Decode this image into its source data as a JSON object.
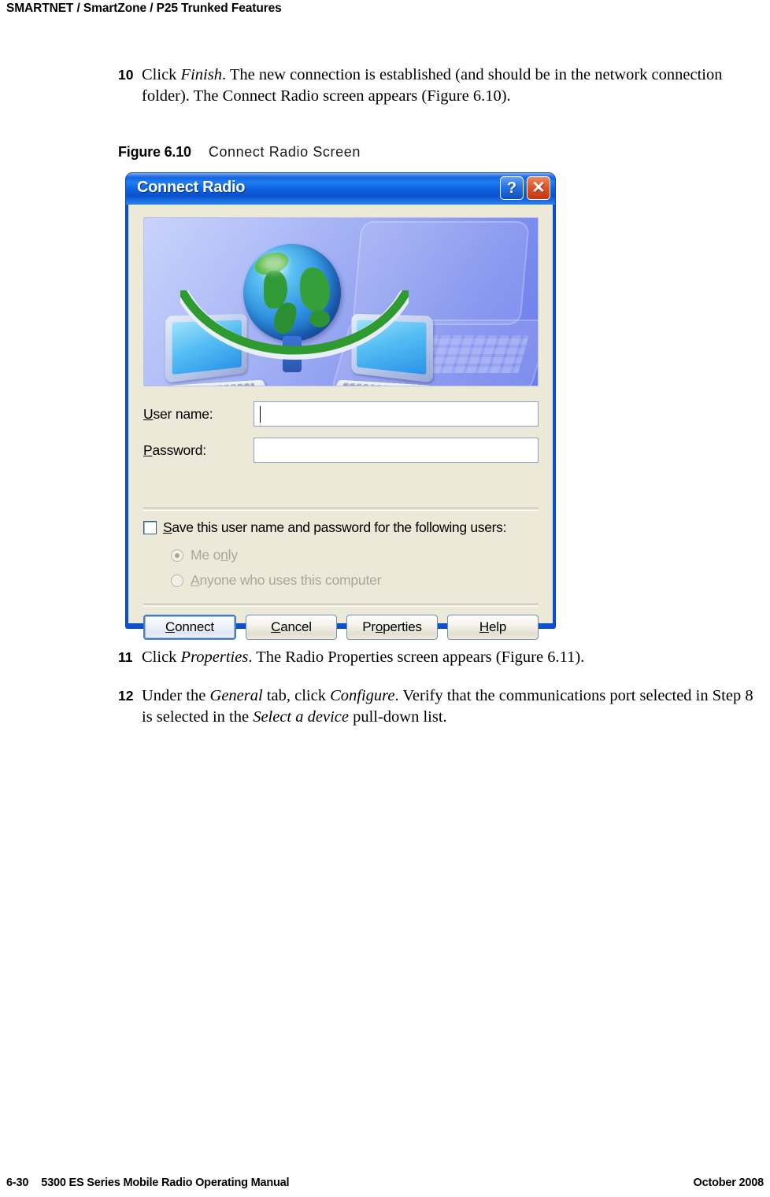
{
  "header": {
    "running_head": "SMARTNET / SmartZone / P25 Trunked Features"
  },
  "steps": [
    {
      "number": "10",
      "text_parts": [
        {
          "text": "Click ",
          "style": "normal"
        },
        {
          "text": "Finish",
          "style": "italic"
        },
        {
          "text": ". The new connection is established (and should be in the network connection folder). The Connect Radio screen appears (Figure 6.10).",
          "style": "normal"
        }
      ],
      "plain": "Click Finish. The new connection is established (and should be in the network connection folder). The Connect Radio screen appears (Figure 6.10)."
    },
    {
      "number": "11",
      "text_parts": [
        {
          "text": "Click ",
          "style": "normal"
        },
        {
          "text": "Properties",
          "style": "italic"
        },
        {
          "text": ". The Radio Properties screen appears (Figure 6.11).",
          "style": "normal"
        }
      ],
      "plain": "Click Properties. The Radio Properties screen appears (Figure 6.11)."
    },
    {
      "number": "12",
      "text_parts": [
        {
          "text": "Under the ",
          "style": "normal"
        },
        {
          "text": "General",
          "style": "italic"
        },
        {
          "text": " tab, click ",
          "style": "normal"
        },
        {
          "text": "Configure",
          "style": "italic"
        },
        {
          "text": ". Verify that the communications port selected in Step 8 is selected in the ",
          "style": "normal"
        },
        {
          "text": "Select a device",
          "style": "italic"
        },
        {
          "text": " pull-down list.",
          "style": "normal"
        }
      ],
      "plain": "Under the General tab, click Configure. Verify that the communications port selected in Step 8 is selected in the Select a device pull-down list."
    }
  ],
  "figure": {
    "label": "Figure 6.10",
    "title": "Connect Radio Screen"
  },
  "dialog": {
    "title": "Connect Radio",
    "title_buttons": {
      "help": "?",
      "close": "✕"
    },
    "banner": {
      "description": "two laptops connected by a green arc with a globe"
    },
    "fields": [
      {
        "label_before": "",
        "accel": "U",
        "label_after": "ser name:",
        "value": "",
        "focused": true
      },
      {
        "label_before": "",
        "accel": "P",
        "label_after": "assword:",
        "value": "",
        "focused": false
      }
    ],
    "checkbox": {
      "accel": "S",
      "label_after": "ave this user name and password for the following users:",
      "checked": false
    },
    "radios": [
      {
        "label_before": "Me o",
        "accel": "n",
        "label_after": "ly",
        "selected": true,
        "disabled": true
      },
      {
        "label_before": "",
        "accel": "A",
        "label_after": "nyone who uses this computer",
        "selected": false,
        "disabled": true
      }
    ],
    "buttons": [
      {
        "accel": "C",
        "label_after": "onnect",
        "label_before": "",
        "default": true
      },
      {
        "accel": "C",
        "label_after": "ancel",
        "label_before": "",
        "default": false
      },
      {
        "accel": "o",
        "label_after": "perties",
        "label_before": "Pr",
        "default": false
      },
      {
        "accel": "H",
        "label_after": "elp",
        "label_before": "",
        "default": false
      }
    ]
  },
  "footer": {
    "page_number": "6-30",
    "manual_title": "5300 ES Series Mobile Radio Operating Manual",
    "date": "October 2008"
  },
  "colors": {
    "titlebar_blue": "#0a58dc",
    "dialog_face": "#ece9d8",
    "close_button": "#e2542a",
    "banner_blue": "#98a7f2",
    "globe_green": "#3da83c"
  }
}
